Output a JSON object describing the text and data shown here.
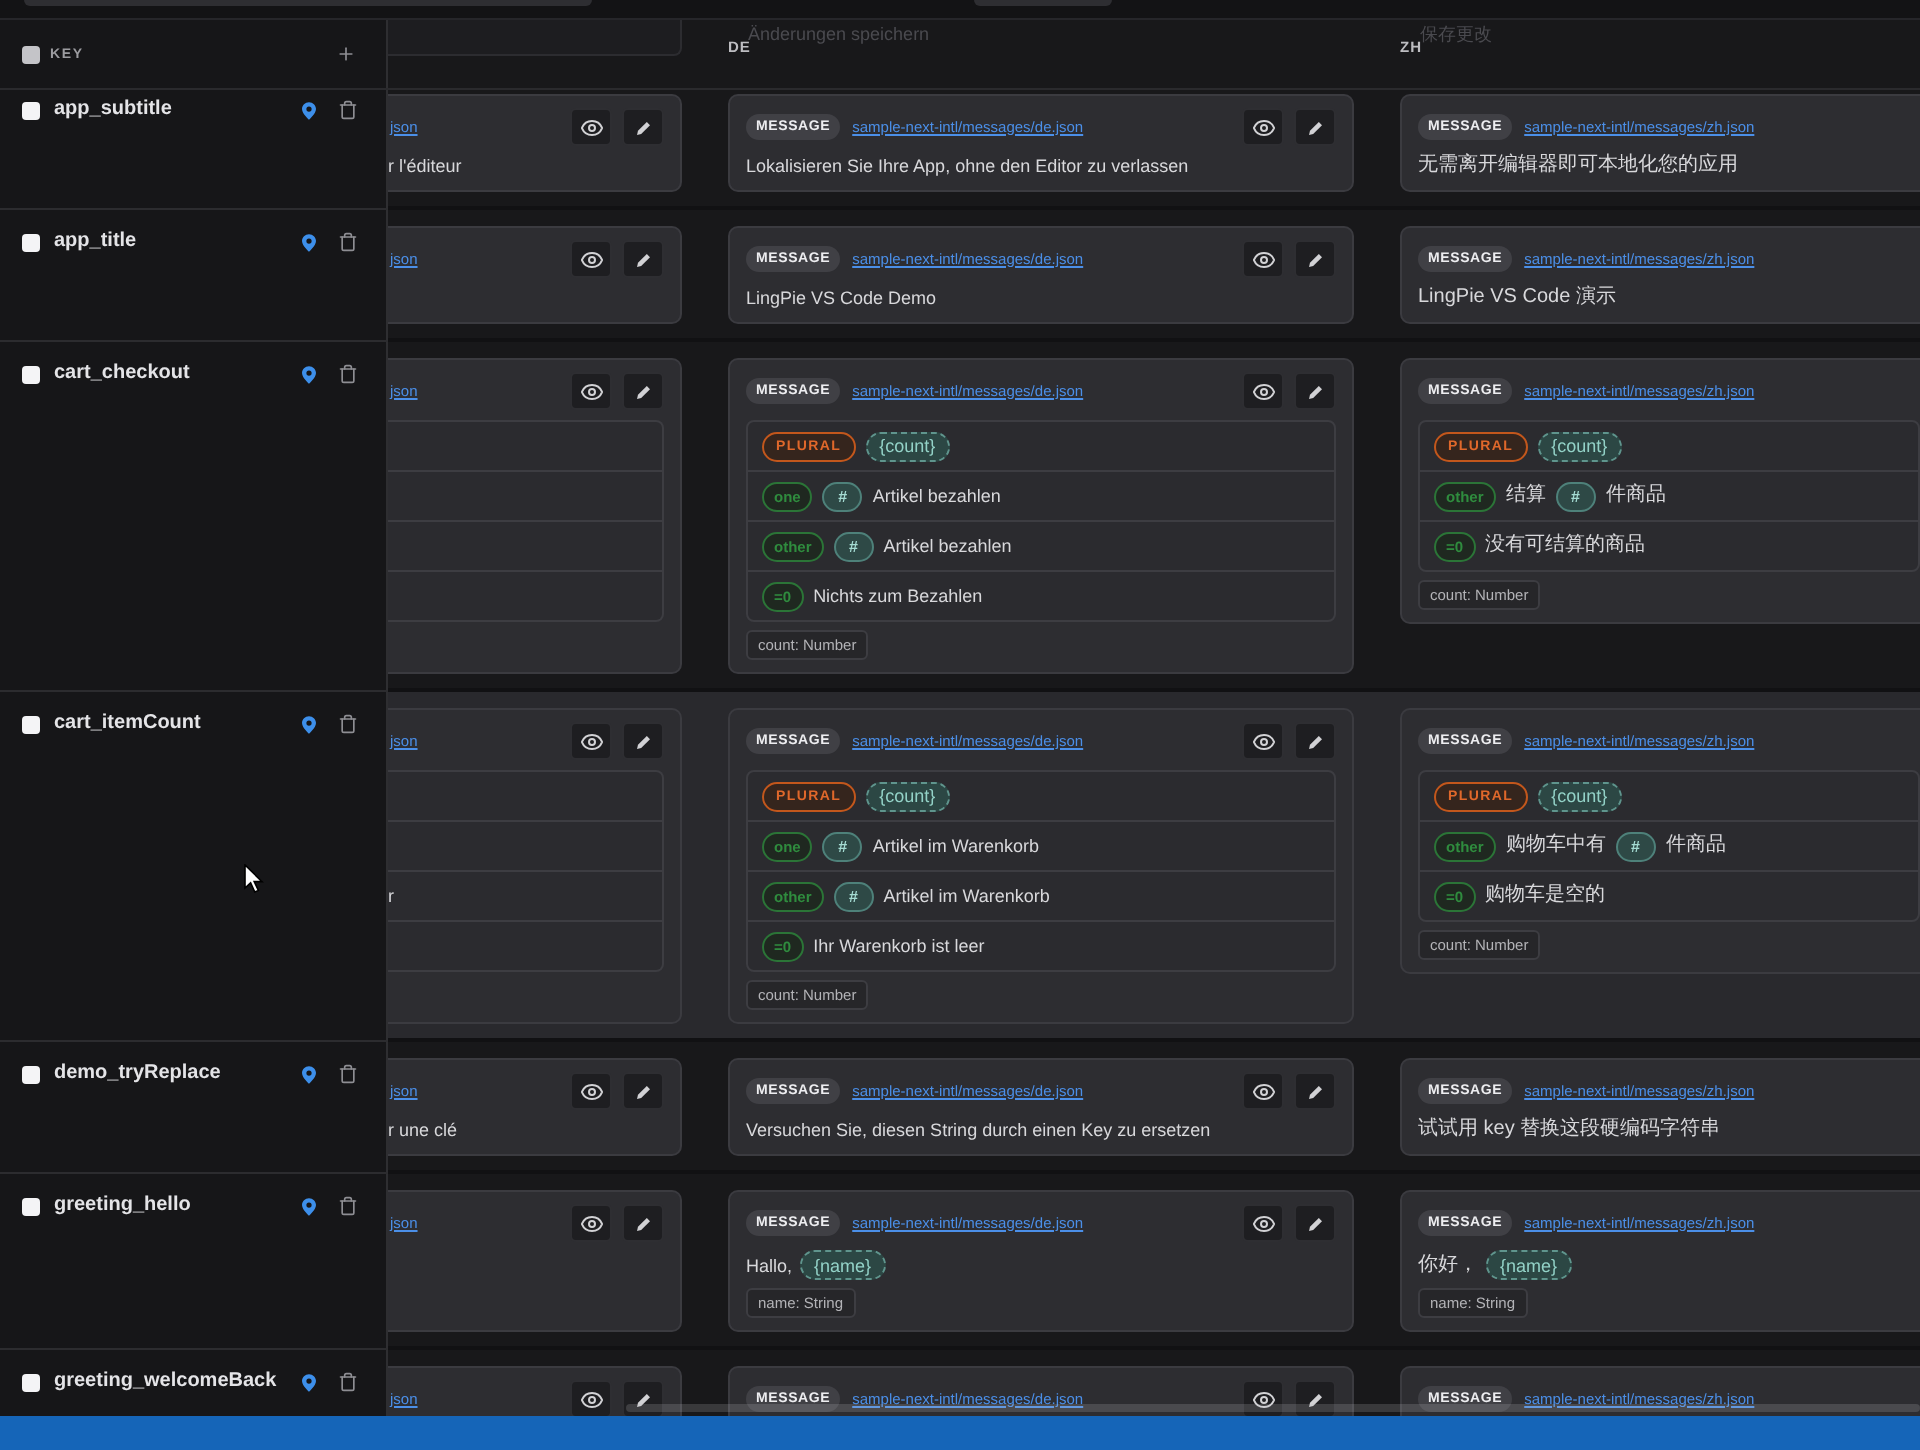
{
  "header": {
    "select_all": {
      "checked": false
    },
    "key_label": "KEY",
    "columns": [
      {
        "kind": "clipped"
      },
      {
        "kind": "full",
        "code": "DE",
        "save_label": "Änderungen speichern"
      },
      {
        "kind": "full",
        "code": "ZH",
        "save_label": "保存更改"
      }
    ]
  },
  "rows": [
    {
      "key": "app_subtitle",
      "checked": false,
      "hovered": false,
      "cells": [
        {
          "kind": "message",
          "file": "json",
          "parts": [
            {
              "kind": "text",
              "text": "r l'éditeur"
            }
          ]
        },
        {
          "kind": "message",
          "badge": "MESSAGE",
          "file": "sample-next-intl/messages/de.json",
          "parts": [
            {
              "kind": "text",
              "text": "Lokalisieren Sie Ihre App, ohne den Editor zu verlassen"
            }
          ]
        },
        {
          "kind": "message",
          "badge": "MESSAGE",
          "file": "sample-next-intl/messages/zh.json",
          "parts": [
            {
              "kind": "text",
              "text": "无需离开编辑器即可本地化您的应用"
            }
          ]
        }
      ]
    },
    {
      "key": "app_title",
      "checked": false,
      "hovered": false,
      "cells": [
        {
          "kind": "message",
          "file": "json"
        },
        {
          "kind": "message",
          "badge": "MESSAGE",
          "file": "sample-next-intl/messages/de.json",
          "parts": [
            {
              "kind": "text",
              "text": "LingPie VS Code Demo"
            }
          ]
        },
        {
          "kind": "message",
          "badge": "MESSAGE",
          "file": "sample-next-intl/messages/zh.json",
          "parts": [
            {
              "kind": "text",
              "text": "LingPie VS Code 演示"
            }
          ]
        }
      ]
    },
    {
      "key": "cart_checkout",
      "checked": false,
      "hovered": false,
      "cells": [
        {
          "kind": "plural",
          "file": "json",
          "plural": {
            "cases": [
              {
                "kind": "clipped"
              },
              {
                "kind": "clipped"
              },
              {
                "kind": "clipped"
              }
            ]
          }
        },
        {
          "kind": "plural",
          "badge": "MESSAGE",
          "file": "sample-next-intl/messages/de.json",
          "plural": {
            "label": "PLURAL",
            "arg": "{count}",
            "cases": [
              {
                "kind": "case",
                "selector": "one",
                "parts": [
                  {
                    "kind": "hash",
                    "text": "#"
                  },
                  {
                    "kind": "text",
                    "text": "Artikel bezahlen"
                  }
                ]
              },
              {
                "kind": "case",
                "selector": "other",
                "parts": [
                  {
                    "kind": "hash",
                    "text": "#"
                  },
                  {
                    "kind": "text",
                    "text": "Artikel bezahlen"
                  }
                ]
              },
              {
                "kind": "case",
                "selector": "=0",
                "parts": [
                  {
                    "kind": "text",
                    "text": "Nichts zum Bezahlen"
                  }
                ]
              }
            ]
          },
          "args": [
            "count: Number"
          ]
        },
        {
          "kind": "plural",
          "badge": "MESSAGE",
          "file": "sample-next-intl/messages/zh.json",
          "plural": {
            "label": "PLURAL",
            "arg": "{count}",
            "cases": [
              {
                "kind": "case",
                "selector": "other",
                "parts": [
                  {
                    "kind": "text",
                    "text": "结算"
                  },
                  {
                    "kind": "hash",
                    "text": "#"
                  },
                  {
                    "kind": "text",
                    "text": "件商品"
                  }
                ]
              },
              {
                "kind": "case",
                "selector": "=0",
                "parts": [
                  {
                    "kind": "text",
                    "text": "没有可结算的商品"
                  }
                ]
              }
            ]
          },
          "args": [
            "count: Number"
          ]
        }
      ]
    },
    {
      "key": "cart_itemCount",
      "checked": false,
      "hovered": true,
      "cells": [
        {
          "kind": "plural",
          "file": "json",
          "plural": {
            "cases": [
              {
                "kind": "clipped"
              },
              {
                "kind": "clipped",
                "parts": [
                  {
                    "kind": "text",
                    "text": "r"
                  }
                ]
              },
              {
                "kind": "clipped"
              }
            ]
          }
        },
        {
          "kind": "plural",
          "badge": "MESSAGE",
          "file": "sample-next-intl/messages/de.json",
          "plural": {
            "label": "PLURAL",
            "arg": "{count}",
            "cases": [
              {
                "kind": "case",
                "selector": "one",
                "parts": [
                  {
                    "kind": "hash",
                    "text": "#"
                  },
                  {
                    "kind": "text",
                    "text": "Artikel im Warenkorb"
                  }
                ]
              },
              {
                "kind": "case",
                "selector": "other",
                "parts": [
                  {
                    "kind": "hash",
                    "text": "#"
                  },
                  {
                    "kind": "text",
                    "text": "Artikel im Warenkorb"
                  }
                ]
              },
              {
                "kind": "case",
                "selector": "=0",
                "parts": [
                  {
                    "kind": "text",
                    "text": "Ihr Warenkorb ist leer"
                  }
                ]
              }
            ]
          },
          "args": [
            "count: Number"
          ]
        },
        {
          "kind": "plural",
          "badge": "MESSAGE",
          "file": "sample-next-intl/messages/zh.json",
          "plural": {
            "label": "PLURAL",
            "arg": "{count}",
            "cases": [
              {
                "kind": "case",
                "selector": "other",
                "parts": [
                  {
                    "kind": "text",
                    "text": "购物车中有"
                  },
                  {
                    "kind": "hash",
                    "text": "#"
                  },
                  {
                    "kind": "text",
                    "text": "件商品"
                  }
                ]
              },
              {
                "kind": "case",
                "selector": "=0",
                "parts": [
                  {
                    "kind": "text",
                    "text": "购物车是空的"
                  }
                ]
              }
            ]
          },
          "args": [
            "count: Number"
          ]
        }
      ]
    },
    {
      "key": "demo_tryReplace",
      "checked": false,
      "hovered": false,
      "cells": [
        {
          "kind": "message",
          "file": "json",
          "parts": [
            {
              "kind": "text",
              "text": "r une clé"
            }
          ]
        },
        {
          "kind": "message",
          "badge": "MESSAGE",
          "file": "sample-next-intl/messages/de.json",
          "parts": [
            {
              "kind": "text",
              "text": "Versuchen Sie, diesen String durch einen Key zu ersetzen"
            }
          ]
        },
        {
          "kind": "message",
          "badge": "MESSAGE",
          "file": "sample-next-intl/messages/zh.json",
          "parts": [
            {
              "kind": "text",
              "text": "试试用 key 替换这段硬编码字符串"
            }
          ]
        }
      ]
    },
    {
      "key": "greeting_hello",
      "checked": false,
      "hovered": false,
      "cells": [
        {
          "kind": "message",
          "file": "json"
        },
        {
          "kind": "message",
          "badge": "MESSAGE",
          "file": "sample-next-intl/messages/de.json",
          "parts": [
            {
              "kind": "text",
              "text": "Hallo,"
            },
            {
              "kind": "arg",
              "text": "{name}"
            }
          ],
          "args": [
            "name: String"
          ]
        },
        {
          "kind": "message",
          "badge": "MESSAGE",
          "file": "sample-next-intl/messages/zh.json",
          "parts": [
            {
              "kind": "text",
              "text": "你好，"
            },
            {
              "kind": "arg",
              "text": "{name}"
            }
          ],
          "args": [
            "name: String"
          ]
        }
      ]
    },
    {
      "key": "greeting_welcomeBack",
      "checked": false,
      "hovered": false,
      "cells": [
        {
          "kind": "message",
          "file": "json"
        },
        {
          "kind": "message",
          "badge": "MESSAGE",
          "file": "sample-next-intl/messages/de.json"
        },
        {
          "kind": "message",
          "badge": "MESSAGE",
          "file": "sample-next-intl/messages/zh.json"
        }
      ]
    }
  ]
}
